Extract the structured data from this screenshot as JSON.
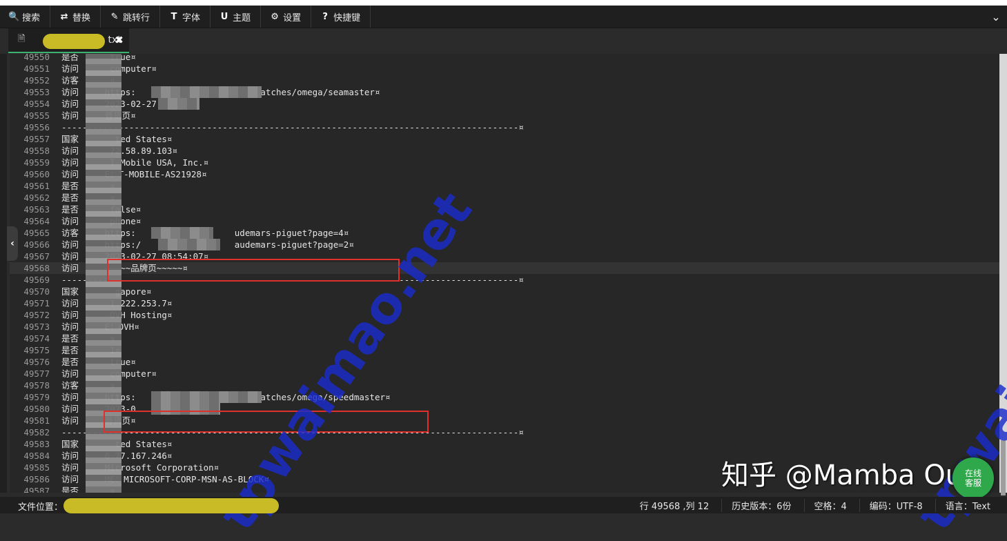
{
  "toolbar": {
    "items": [
      {
        "icon": "search-icon",
        "glyph": "🔍",
        "label": "搜索"
      },
      {
        "icon": "replace-icon",
        "glyph": "⇄",
        "label": "替换"
      },
      {
        "icon": "pin-icon",
        "glyph": "✎",
        "label": "跳转行"
      },
      {
        "icon": "font-icon",
        "glyph": "T",
        "label": "字体"
      },
      {
        "icon": "theme-icon",
        "glyph": "U",
        "label": "主题"
      },
      {
        "icon": "gear-icon",
        "glyph": "⚙",
        "label": "设置"
      },
      {
        "icon": "help-icon",
        "glyph": "?",
        "label": "快捷键"
      }
    ],
    "collapse_glyph": "⌄"
  },
  "tab": {
    "name": "txt",
    "close_glyph": "✖",
    "file_glyph": "🗎"
  },
  "editor": {
    "lines": [
      {
        "n": "49550",
        "t": "是否      true¤"
      },
      {
        "n": "49551",
        "t": "访问      computer¤"
      },
      {
        "n": "49552",
        "t": "访客      ¤"
      },
      {
        "n": "49553",
        "t": "访问     https:                    ll-watches/omega/seamaster¤"
      },
      {
        "n": "49554",
        "t": "访问     2023-02-27 08:52:4"
      },
      {
        "n": "49555",
        "t": "访问     普货页¤"
      },
      {
        "n": "49556",
        "t": "----------------------------------------------------------------------------------------¤"
      },
      {
        "n": "49557",
        "t": "国家       ted States¤"
      },
      {
        "n": "49558",
        "t": "访问      72.58.89.103¤"
      },
      {
        "n": "49559",
        "t": "访问      T-Mobile USA, Inc.¤"
      },
      {
        "n": "49560",
        "t": "访问     E：T-MOBILE-AS21928¤"
      },
      {
        "n": "49561",
        "t": "是否      ¤"
      },
      {
        "n": "49562",
        "t": "是否      ¤"
      },
      {
        "n": "49563",
        "t": "是否      false¤"
      },
      {
        "n": "49564",
        "t": "访问      phone¤"
      },
      {
        "n": "49565",
        "t": "访客     https:                   udemars-piguet?page=4¤"
      },
      {
        "n": "49566",
        "t": "访问     https:/                  audemars-piguet?page=2¤"
      },
      {
        "n": "49567",
        "t": "访问     2023-02-27 08:54:07¤"
      },
      {
        "n": "49568",
        "t": "访问     ~~~~~品牌页~~~~~¤"
      },
      {
        "n": "49569",
        "t": "----------------------------------------------------------------------------------------¤"
      },
      {
        "n": "49570",
        "t": "国家       gapore¤"
      },
      {
        "n": "49571",
        "t": "访问      1.222.253.7¤"
      },
      {
        "n": "49572",
        "t": "访问      OVH Hosting¤"
      },
      {
        "n": "49573",
        "t": "访问     E：OVH¤"
      },
      {
        "n": "49574",
        "t": "是否      ¤"
      },
      {
        "n": "49575",
        "t": "是否      1¤"
      },
      {
        "n": "49576",
        "t": "是否      true¤"
      },
      {
        "n": "49577",
        "t": "访问      computer¤"
      },
      {
        "n": "49578",
        "t": "访客      ¤"
      },
      {
        "n": "49579",
        "t": "访问     https:                    ll-watches/omega/speedmaster¤"
      },
      {
        "n": "49580",
        "t": "访问     2023-0"
      },
      {
        "n": "49581",
        "t": "访问     普货页¤"
      },
      {
        "n": "49582",
        "t": "----------------------------------------------------------------------------------------¤"
      },
      {
        "n": "49583",
        "t": "国家       ted States¤"
      },
      {
        "n": "49584",
        "t": "访问     0.77.167.246¤"
      },
      {
        "n": "49585",
        "t": "访问     Microsoft Corporation¤"
      },
      {
        "n": "49586",
        "t": "访问     ME：MICROSOFT-CORP-MSN-AS-BLOCK¤"
      },
      {
        "n": "49587",
        "t": "是否      ¤"
      }
    ]
  },
  "status": {
    "location_label": "文件位置：",
    "position": "行 49568 ,列 12",
    "history": "历史版本：6份",
    "spaces": "空格：4",
    "encoding": "编码：UTF-8",
    "language": "语言：Text"
  },
  "overlay": {
    "watermark": "tpwaimao.net",
    "watermark2": "tpwai",
    "zhihu": "知乎 @Mamba Out",
    "online_line1": "在线",
    "online_line2": "客服"
  },
  "colors": {
    "accent_tab": "#3cb371",
    "highlight_box": "#e0302b",
    "watermark": "#1a2ccc",
    "redaction": "#c9bb25"
  }
}
